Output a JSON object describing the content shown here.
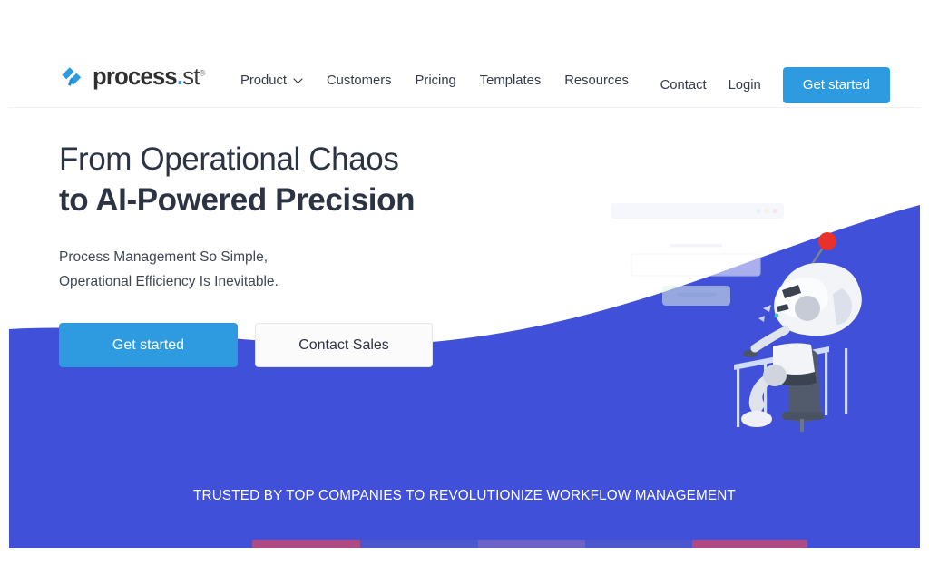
{
  "brand": {
    "name": "process.st",
    "name_main": "process",
    "name_dot": ".",
    "name_suffix": "st",
    "trademark": "®",
    "logo_icon": "process-st-logo-icon",
    "accent_blue": "#2e9ae0",
    "band_blue": "#4050d8",
    "heading_color": "#2c3444"
  },
  "header": {
    "nav": [
      {
        "label": "Product",
        "has_dropdown": true,
        "icon": "chevron-down-icon"
      },
      {
        "label": "Customers",
        "has_dropdown": false
      },
      {
        "label": "Pricing",
        "has_dropdown": false
      },
      {
        "label": "Templates",
        "has_dropdown": false
      },
      {
        "label": "Resources",
        "has_dropdown": false
      }
    ],
    "contact_label": "Contact",
    "login_label": "Login",
    "cta_label": "Get started"
  },
  "hero": {
    "headline_line1": "From Operational Chaos",
    "headline_line2": "to AI-Powered Precision",
    "subhead_line1": "Process Management So Simple,",
    "subhead_line2": "Operational Efficiency Is Inevitable.",
    "primary_cta": "Get started",
    "secondary_cta": "Contact Sales",
    "illustration": "robot-at-desk-illustration"
  },
  "band": {
    "text": "TRUSTED BY TOP COMPANIES TO REVOLUTIONIZE WORKFLOW MANAGEMENT",
    "partner_logo_colors": [
      "#b04a84",
      "#4a57cf",
      "#6d63c6",
      "#4a57cf",
      "#b04a84"
    ]
  }
}
